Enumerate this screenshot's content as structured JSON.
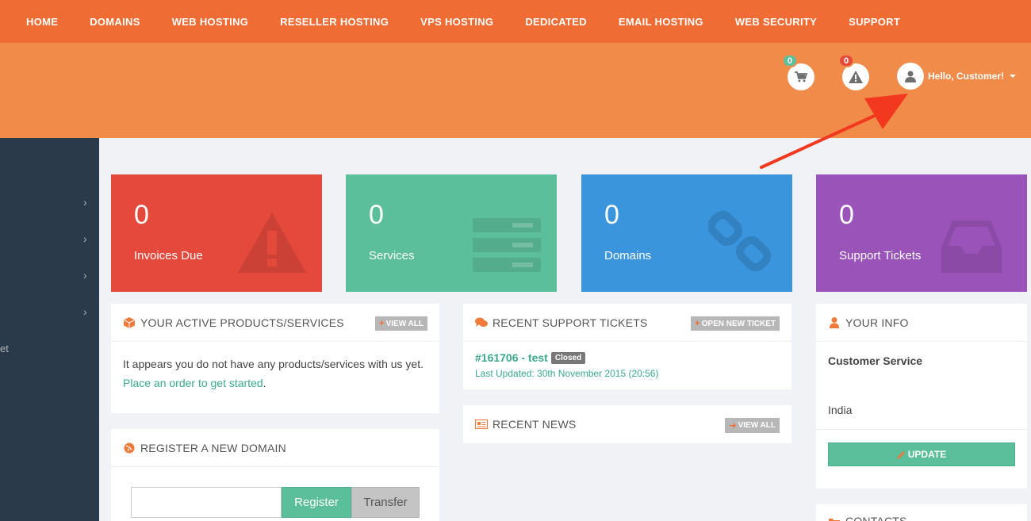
{
  "nav": {
    "items": [
      "HOME",
      "DOMAINS",
      "WEB HOSTING",
      "RESELLER HOSTING",
      "VPS HOSTING",
      "DEDICATED",
      "EMAIL HOSTING",
      "WEB SECURITY",
      "SUPPORT"
    ]
  },
  "header": {
    "cart_count": "0",
    "alerts_count": "0",
    "greeting": "Hello, Customer!",
    "cart_badge_color": "#5cbf9b",
    "alerts_badge_color": "#e4493b"
  },
  "sidebar": {
    "partial_label": "et"
  },
  "tiles": [
    {
      "value": "0",
      "label": "Invoices Due",
      "color": "#e4493b"
    },
    {
      "value": "0",
      "label": "Services",
      "color": "#5cbf9b"
    },
    {
      "value": "0",
      "label": "Domains",
      "color": "#3a95dd"
    },
    {
      "value": "0",
      "label": "Support Tickets",
      "color": "#9a53b9"
    }
  ],
  "products_panel": {
    "title": "YOUR ACTIVE PRODUCTS/SERVICES",
    "button": "VIEW ALL",
    "text": "It appears you do not have any products/services with us yet.",
    "link": "Place an order to get started",
    "link_suffix": "."
  },
  "tickets_panel": {
    "title": "RECENT SUPPORT TICKETS",
    "button": "OPEN NEW TICKET",
    "ticket_id": "#161706 - test",
    "ticket_status": "Closed",
    "ticket_updated": "Last Updated: 30th November 2015 (20:56)"
  },
  "news_panel": {
    "title": "RECENT NEWS",
    "button": "VIEW ALL"
  },
  "info_panel": {
    "title": "YOUR INFO",
    "name": "Customer Service",
    "country": "India",
    "button": "UPDATE"
  },
  "domain_panel": {
    "title": "REGISTER A NEW DOMAIN",
    "input_value": "",
    "register": "Register",
    "transfer": "Transfer"
  },
  "contacts_panel": {
    "title": "CONTACTS"
  },
  "colors": {
    "brand": "#ef6c35",
    "accent": "#5cbf9b",
    "arrow": "#f2391f"
  }
}
